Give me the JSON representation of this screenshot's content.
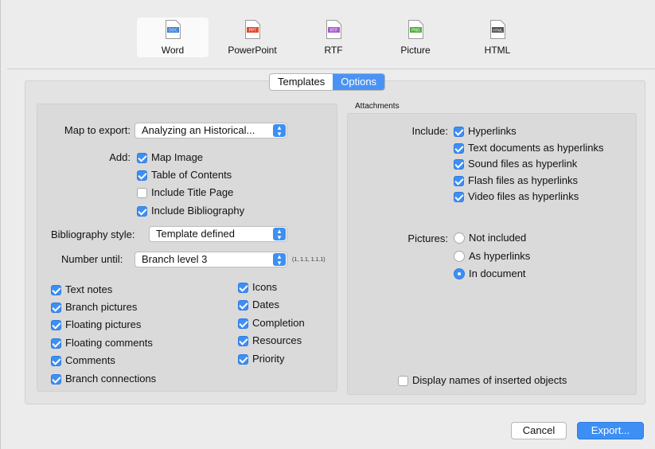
{
  "formats": [
    {
      "label": "Word",
      "badge": "DOC",
      "color": "#3b7ed7",
      "selected": true
    },
    {
      "label": "PowerPoint",
      "badge": "PPT",
      "color": "#e04a2f",
      "selected": false
    },
    {
      "label": "RTF",
      "badge": "RTF",
      "color": "#a95bd0",
      "selected": false
    },
    {
      "label": "Picture",
      "badge": "PNG",
      "color": "#4fae3c",
      "selected": false
    },
    {
      "label": "HTML",
      "badge": "HTML",
      "color": "#555555",
      "selected": false
    }
  ],
  "tabs": {
    "templates": "Templates",
    "options": "Options"
  },
  "left": {
    "map_label": "Map to export:",
    "map_value": "Analyzing an Historical...",
    "add_label": "Add:",
    "add_items": [
      {
        "label": "Map Image",
        "checked": true
      },
      {
        "label": "Table of Contents",
        "checked": true
      },
      {
        "label": "Include Title Page",
        "checked": false
      },
      {
        "label": "Include Bibliography",
        "checked": true
      }
    ],
    "bib_label": "Bibliography style:",
    "bib_value": "Template defined",
    "number_label": "Number until:",
    "number_value": "Branch level 3",
    "number_hint": "(1, 1.1, 1.1.1)",
    "col1": [
      {
        "label": "Text notes",
        "checked": true
      },
      {
        "label": "Branch pictures",
        "checked": true
      },
      {
        "label": "Floating pictures",
        "checked": true
      },
      {
        "label": "Floating comments",
        "checked": true
      },
      {
        "label": "Comments",
        "checked": true
      },
      {
        "label": "Branch connections",
        "checked": true
      }
    ],
    "col2": [
      {
        "label": "Icons",
        "checked": true
      },
      {
        "label": "Dates",
        "checked": true
      },
      {
        "label": "Completion",
        "checked": true
      },
      {
        "label": "Resources",
        "checked": true
      },
      {
        "label": "Priority",
        "checked": true
      }
    ]
  },
  "right": {
    "title": "Attachments",
    "include_label": "Include:",
    "include_items": [
      {
        "label": "Hyperlinks",
        "checked": true
      },
      {
        "label": "Text documents as hyperlinks",
        "checked": true
      },
      {
        "label": "Sound files as hyperlink",
        "checked": true
      },
      {
        "label": "Flash files as hyperlinks",
        "checked": true
      },
      {
        "label": "Video files as hyperlinks",
        "checked": true
      }
    ],
    "pictures_label": "Pictures:",
    "pictures_options": [
      {
        "label": "Not included",
        "selected": false
      },
      {
        "label": "As hyperlinks",
        "selected": false
      },
      {
        "label": "In document",
        "selected": true
      }
    ],
    "display_names": {
      "label": "Display names of inserted objects",
      "checked": false
    }
  },
  "buttons": {
    "cancel": "Cancel",
    "export": "Export..."
  }
}
